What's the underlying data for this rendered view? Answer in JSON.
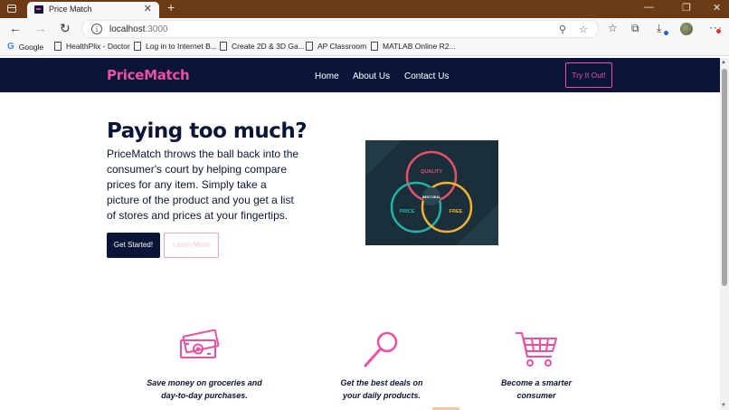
{
  "browser": {
    "tab_title": "Price Match",
    "tab_close": "✕",
    "new_tab": "+",
    "url_host": "localhost",
    "url_port": ":3000",
    "window_controls": [
      "—",
      "❐",
      "✕"
    ],
    "bookmarks": [
      {
        "label": "Google",
        "icon": "google-icon"
      },
      {
        "label": "HealthPlix - Doctor",
        "icon": "page-icon"
      },
      {
        "label": "Log in to Internet B...",
        "icon": "page-icon"
      },
      {
        "label": "Create 2D & 3D Ga...",
        "icon": "page-icon"
      },
      {
        "label": "AP Classroom",
        "icon": "page-icon"
      },
      {
        "label": "MATLAB Online R2...",
        "icon": "page-icon"
      }
    ]
  },
  "site": {
    "brand": "PriceMatch",
    "nav": [
      "Home",
      "About Us",
      "Contact Us"
    ],
    "cta": "Try It Out!",
    "hero": {
      "title": "Paying too much?",
      "text": "PriceMatch throws the ball back into the consumer's court by helping compare prices for any item. Simply take a picture of the product and you get a list of stores and prices at your fingertips.",
      "primary_button": "Get Started!",
      "secondary_button": "Learn More"
    },
    "venn": {
      "labels": [
        "QUALITY",
        "PRICE",
        "FREE",
        "BEST DEAL"
      ],
      "colors": {
        "quality": "#e8506a",
        "price": "#1fb5a6",
        "free": "#f2b134",
        "bg": "#1b2f3a"
      }
    },
    "features": [
      {
        "icon": "money-icon",
        "line1": "Save money on groceries and",
        "line2": "day-to-day purchases."
      },
      {
        "icon": "magnifier-icon",
        "line1": "Get the best deals on",
        "line2": "your daily products."
      },
      {
        "icon": "cart-icon",
        "line1": "Become a smarter",
        "line2": "consumer"
      }
    ],
    "colors": {
      "navy": "#0a1538",
      "pink": "#ee4fa3"
    }
  }
}
